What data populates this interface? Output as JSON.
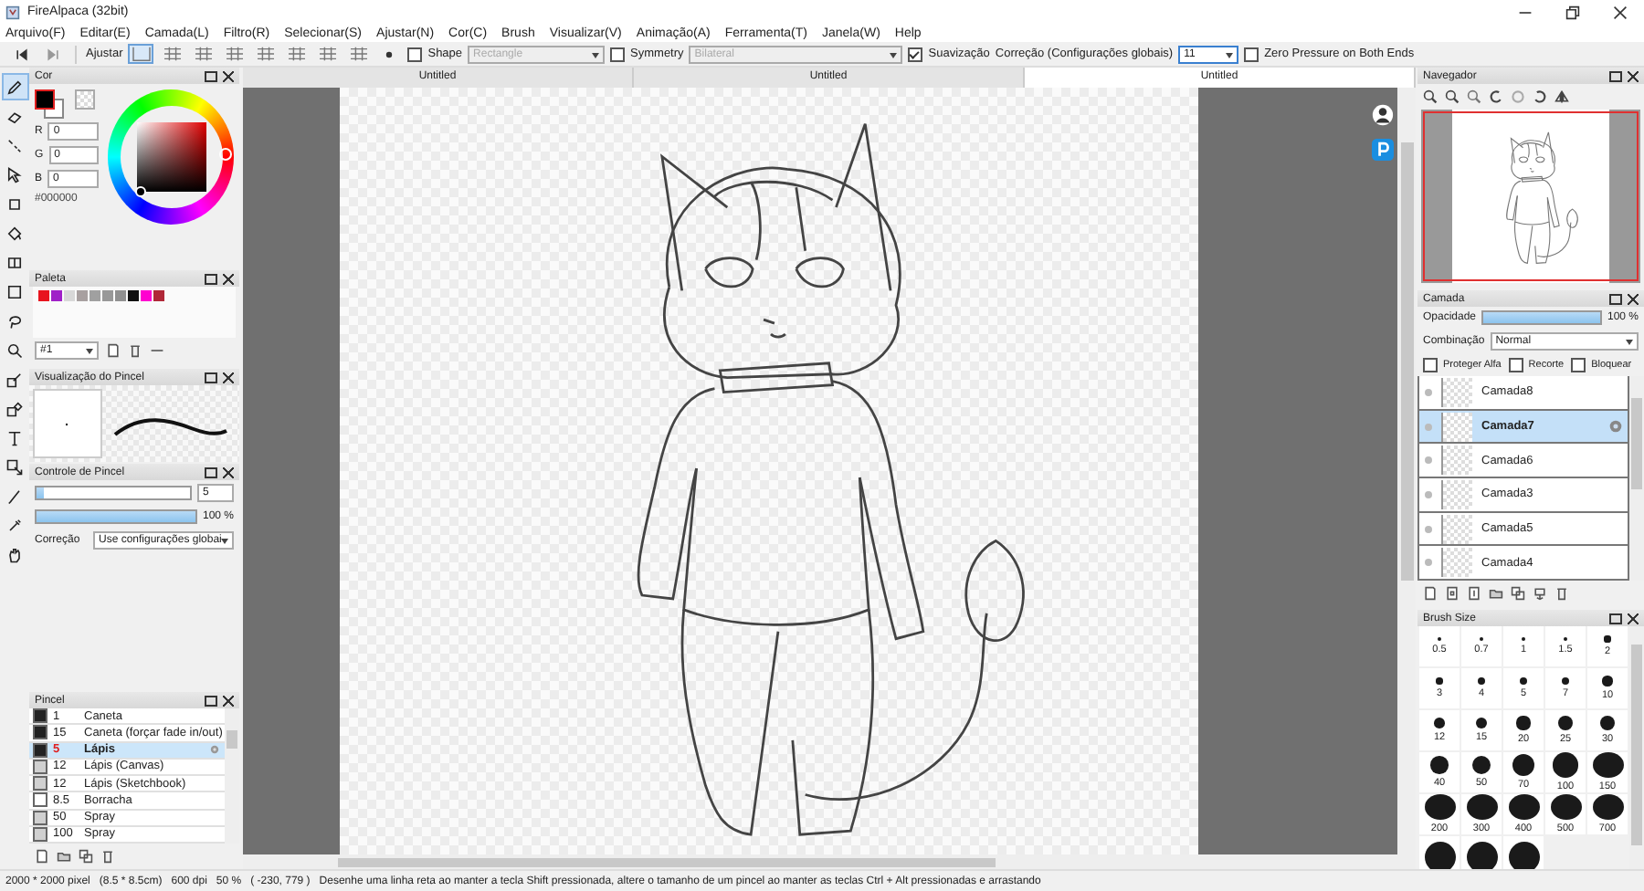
{
  "window": {
    "title": "FireAlpaca (32bit)"
  },
  "menu": [
    "Arquivo(F)",
    "Editar(E)",
    "Camada(L)",
    "Filtro(R)",
    "Selecionar(S)",
    "Ajustar(N)",
    "Cor(C)",
    "Brush",
    "Visualizar(V)",
    "Animação(A)",
    "Ferramenta(T)",
    "Janela(W)",
    "Help"
  ],
  "toolbar": {
    "snap_label": "Ajustar",
    "snaps": [
      {
        "selected": true
      },
      {
        "selected": false
      },
      {
        "selected": false
      },
      {
        "selected": false
      },
      {
        "selected": false
      },
      {
        "selected": false
      },
      {
        "selected": false
      },
      {
        "selected": false
      }
    ],
    "shape": {
      "label": "Shape",
      "checked": false,
      "value": "Rectangle",
      "disabled": true
    },
    "symmetry": {
      "label": "Symmetry",
      "checked": false,
      "value": "Bilateral",
      "disabled": true
    },
    "smoothing": {
      "label": "Suavização",
      "checked": true
    },
    "correction": {
      "label": "Correção (Configurações globais)",
      "value": "11"
    },
    "zero_pressure": {
      "label": "Zero Pressure on Both Ends",
      "checked": false
    }
  },
  "tools": [
    {
      "kind": "pen",
      "selected": true
    },
    {
      "kind": "eraser",
      "selected": false
    },
    {
      "kind": "line",
      "selected": false
    },
    {
      "kind": "cursor",
      "selected": false
    },
    {
      "kind": "square",
      "selected": false
    },
    {
      "kind": "bucket",
      "selected": false
    },
    {
      "kind": "gradient",
      "selected": false
    },
    {
      "kind": "marquee",
      "selected": false
    },
    {
      "kind": "lasso",
      "selected": false
    },
    {
      "kind": "magnifier",
      "selected": false
    },
    {
      "kind": "pen-box",
      "selected": false
    },
    {
      "kind": "eraser-box",
      "selected": false
    },
    {
      "kind": "text",
      "selected": false
    },
    {
      "kind": "arrow-box",
      "selected": false
    },
    {
      "kind": "brush",
      "selected": false
    },
    {
      "kind": "eyedropper",
      "selected": false
    },
    {
      "kind": "hand",
      "selected": false
    }
  ],
  "color_panel": {
    "title": "Cor",
    "r": "0",
    "g": "0",
    "b": "0",
    "r_label": "R",
    "g_label": "G",
    "b_label": "B",
    "hex": "#000000"
  },
  "palette": {
    "title": "Paleta",
    "colors": [
      {
        "color": "#e8141e"
      },
      {
        "color": "#a020c8"
      },
      {
        "color": "#d8d8d8"
      },
      {
        "color": "#a8a0a0"
      },
      {
        "color": "#a0a0a0"
      },
      {
        "color": "#989898"
      },
      {
        "color": "#909090"
      },
      {
        "color": "#101010"
      },
      {
        "color": "#ff00d0"
      },
      {
        "color": "#b02838"
      }
    ],
    "set": "#1"
  },
  "brush_preview": {
    "title": "Visualização do Pincel"
  },
  "brush_control": {
    "title": "Controle de Pincel",
    "size_slider": {
      "level": 0.05
    },
    "size": "5",
    "opacity_slider": {
      "level": 1
    },
    "opacity": "100 %",
    "correction_label": "Correção",
    "correction": "Use configurações globai"
  },
  "brushes": {
    "title": "Pincel",
    "items": [
      {
        "color": "#222222",
        "size": "1",
        "name": "Caneta",
        "selected": false
      },
      {
        "color": "#222222",
        "size": "15",
        "name": "Caneta (forçar fade in/out)",
        "selected": false
      },
      {
        "color": "#222222",
        "size": "5",
        "name": "Lápis",
        "selected": true
      },
      {
        "color": "#d0d0d0",
        "size": "12",
        "name": "Lápis (Canvas)",
        "selected": false
      },
      {
        "color": "#d0d0d0",
        "size": "12",
        "name": "Lápis (Sketchbook)",
        "selected": false
      },
      {
        "color": "#ffffff",
        "size": "8.5",
        "name": "Borracha",
        "selected": false
      },
      {
        "color": "#d0d0d0",
        "size": "50",
        "name": "Spray",
        "selected": false
      },
      {
        "color": "#d0d0d0",
        "size": "100",
        "name": "Spray",
        "selected": false
      }
    ]
  },
  "tabs": [
    {
      "label": "Untitled",
      "selected": false
    },
    {
      "label": "Untitled",
      "selected": false
    },
    {
      "label": "Untitled",
      "selected": true
    }
  ],
  "navigator": {
    "title": "Navegador"
  },
  "layers": {
    "title": "Camada",
    "opacity_label": "Opacidade",
    "opacity_slider": {
      "level": 1
    },
    "opacity": "100 %",
    "blend_label": "Combinação",
    "blend": "Normal",
    "options": [
      {
        "label": "Proteger Alfa",
        "checked": false
      },
      {
        "label": "Recorte",
        "checked": false
      },
      {
        "label": "Bloquear",
        "checked": false
      }
    ],
    "items": [
      {
        "name": "Camada8",
        "selected": false
      },
      {
        "name": "Camada7",
        "selected": true
      },
      {
        "name": "Camada6",
        "selected": false
      },
      {
        "name": "Camada3",
        "selected": false
      },
      {
        "name": "Camada5",
        "selected": false
      },
      {
        "name": "Camada4",
        "selected": false
      }
    ]
  },
  "brush_size": {
    "title": "Brush Size",
    "items": [
      {
        "kind": "labeled",
        "label": "0.5"
      },
      {
        "kind": "labeled",
        "label": "0.7"
      },
      {
        "kind": "labeled",
        "label": "1"
      },
      {
        "kind": "labeled",
        "label": "1.5"
      },
      {
        "kind": "labeled",
        "label": "2"
      },
      {
        "kind": "labeled",
        "label": "3"
      },
      {
        "kind": "labeled",
        "label": "4"
      },
      {
        "kind": "labeled",
        "label": "5"
      },
      {
        "kind": "labeled",
        "label": "7"
      },
      {
        "kind": "labeled",
        "label": "10"
      },
      {
        "kind": "labeled",
        "label": "12"
      },
      {
        "kind": "labeled",
        "label": "15"
      },
      {
        "kind": "labeled",
        "label": "20"
      },
      {
        "kind": "labeled",
        "label": "25"
      },
      {
        "kind": "labeled",
        "label": "30"
      },
      {
        "kind": "labeled",
        "label": "40"
      },
      {
        "kind": "labeled",
        "label": "50"
      },
      {
        "kind": "labeled",
        "label": "70"
      },
      {
        "kind": "labeled",
        "label": "100"
      },
      {
        "kind": "labeled",
        "label": "150"
      },
      {
        "kind": "labeled",
        "label": "200"
      },
      {
        "kind": "labeled",
        "label": "300"
      },
      {
        "kind": "labeled",
        "label": "400"
      },
      {
        "kind": "labeled",
        "label": "500"
      },
      {
        "kind": "labeled",
        "label": "700"
      },
      {
        "kind": "cut"
      },
      {
        "kind": "cut"
      },
      {
        "kind": "cut"
      }
    ]
  },
  "status_bar": {
    "size": "2000 * 2000 pixel",
    "cm": "(8.5 * 8.5cm)",
    "dpi": "600 dpi",
    "zoom": "50 %",
    "coords": "( -230, 779 )",
    "hint": "Desenhe uma linha reta ao manter a tecla Shift pressionada, altere o tamanho de um pincel ao manter as teclas Ctrl + Alt pressionadas e arrastando"
  }
}
